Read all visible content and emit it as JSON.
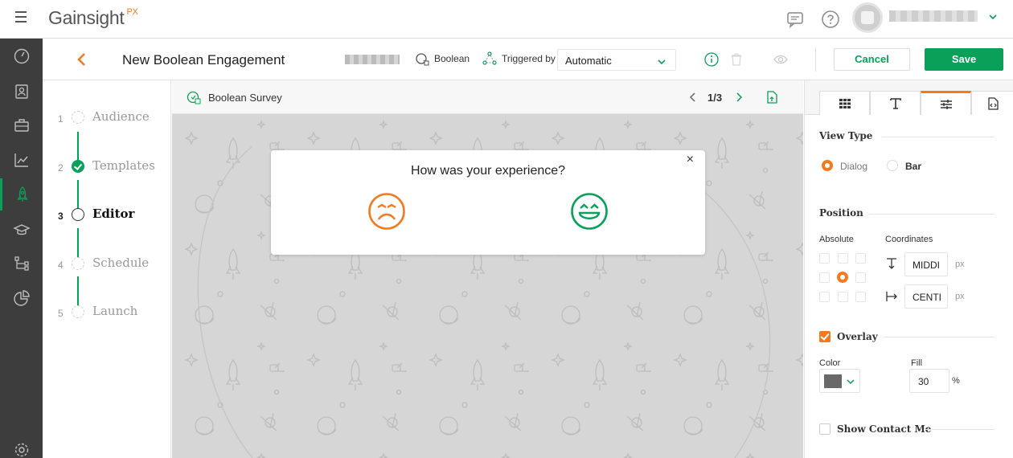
{
  "app": {
    "logo_text": "Gainsight",
    "logo_suffix": "PX",
    "brand_color": "#0aa05a",
    "accent_color": "#f47a20"
  },
  "topbar": {
    "icons": [
      "menu-icon",
      "chat-icon",
      "help-icon",
      "avatar",
      "chevron-down-icon"
    ]
  },
  "rail": {
    "items": [
      {
        "name": "dashboard-icon",
        "active": false
      },
      {
        "name": "people-icon",
        "active": false
      },
      {
        "name": "briefcase-icon",
        "active": false
      },
      {
        "name": "analytics-icon",
        "active": false
      },
      {
        "name": "rocket-icon",
        "active": true
      },
      {
        "name": "knowledge-center-icon",
        "active": false
      },
      {
        "name": "journey-icon",
        "active": false
      },
      {
        "name": "pie-chart-icon",
        "active": false
      },
      {
        "name": "settings-icon",
        "active": false
      }
    ]
  },
  "header": {
    "title": "New Boolean Engagement",
    "type_label": "Boolean",
    "triggered_label": "Triggered by",
    "trigger_value": "Automatic",
    "cancel_label": "Cancel",
    "save_label": "Save"
  },
  "steps": [
    {
      "num": "1",
      "label": "Audience",
      "state": "pending"
    },
    {
      "num": "2",
      "label": "Templates",
      "state": "done"
    },
    {
      "num": "3",
      "label": "Editor",
      "state": "current"
    },
    {
      "num": "4",
      "label": "Schedule",
      "state": "pending"
    },
    {
      "num": "5",
      "label": "Launch",
      "state": "pending"
    }
  ],
  "preview": {
    "survey_name": "Boolean Survey",
    "page": "1/3",
    "question": "How was your experience?",
    "close": "×",
    "negative_icon": "sad-face-icon",
    "positive_icon": "happy-face-icon"
  },
  "panel": {
    "tabs": [
      "grid-icon",
      "text-icon",
      "sliders-icon",
      "code-icon"
    ],
    "active_tab": 2,
    "view_type": {
      "title": "View Type",
      "options": [
        "Dialog",
        "Bar"
      ],
      "selected": "Dialog"
    },
    "position": {
      "title": "Position",
      "absolute_label": "Absolute",
      "coordinates_label": "Coordinates",
      "selected_cell": "center",
      "vertical_value": "MIDDI",
      "horizontal_value": "CENTI",
      "unit": "px"
    },
    "overlay": {
      "label": "Overlay",
      "checked": true,
      "color_label": "Color",
      "color_value": "#696969",
      "fill_label": "Fill",
      "fill_value": "30",
      "fill_unit": "%"
    },
    "contact": {
      "label": "Show Contact Me",
      "checked": false
    }
  }
}
